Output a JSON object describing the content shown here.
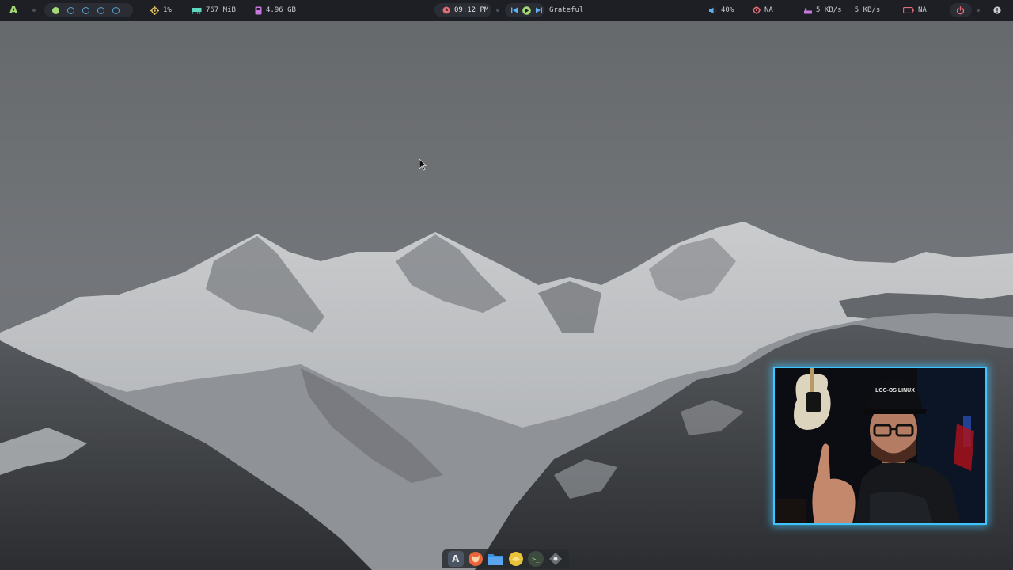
{
  "topbar": {
    "launcher": {
      "glyph": "A"
    },
    "workspaces": [
      {
        "state": "active"
      },
      {
        "state": "empty"
      },
      {
        "state": "empty"
      },
      {
        "state": "empty"
      },
      {
        "state": "empty"
      }
    ],
    "cpu": {
      "icon": "cpu-icon",
      "value": "1%",
      "color": "#e0c060"
    },
    "memory": {
      "icon": "memory-icon",
      "value": "767 MiB",
      "color": "#5fd7c0"
    },
    "disk": {
      "icon": "disk-icon",
      "value": "4.96 GB",
      "color": "#c678dd"
    },
    "clock": {
      "icon": "clock-icon",
      "value": "09:12 PM",
      "color": "#e06c75"
    },
    "media": {
      "prev_icon": "previous-track-icon",
      "play_icon": "play-icon",
      "next_icon": "next-track-icon",
      "title": "Grateful",
      "color": "#61afef",
      "play_color": "#a3d977"
    },
    "volume": {
      "icon": "volume-icon",
      "value": "40%",
      "color": "#61afef"
    },
    "network": {
      "icon": "network-icon",
      "value": "NA",
      "color": "#e06c75"
    },
    "speed": {
      "icon": "upload-icon",
      "value": "5 KB/s | 5 KB/s",
      "color": "#c678dd"
    },
    "battery": {
      "icon": "battery-icon",
      "value": "NA",
      "color": "#e06c75"
    },
    "power": {
      "icon": "power-icon",
      "color": "#e06c75"
    },
    "tray": {
      "icon": "tray-icon"
    }
  },
  "dock": {
    "apps": [
      {
        "name": "archcraft-launcher",
        "glyph": "A",
        "color": "#4b5563"
      },
      {
        "name": "firefox",
        "glyph": "",
        "color": "#e8643a"
      },
      {
        "name": "file-manager",
        "glyph": "",
        "color": "#3b8fe0"
      },
      {
        "name": "app-yellow",
        "glyph": "",
        "color": "#e8c33a"
      },
      {
        "name": "terminal",
        "glyph": ">_",
        "color": "#3d4a40"
      },
      {
        "name": "settings",
        "glyph": "",
        "color": "#555a60"
      }
    ]
  },
  "webcam": {
    "border_color": "#40c4ff",
    "cap_text": "LCC-OS LINUX"
  }
}
